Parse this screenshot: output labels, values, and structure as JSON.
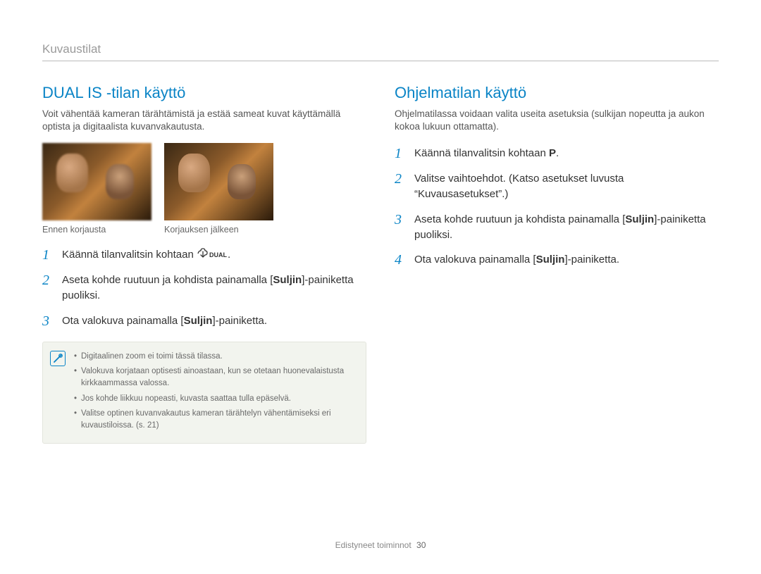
{
  "chapter": "Kuvaustilat",
  "left": {
    "heading": "DUAL IS -tilan käyttö",
    "intro": "Voit vähentää kameran tärähtämistä ja estää sameat kuvat käyttämällä optista ja digitaalista kuvanvakautusta.",
    "photo_before_caption": "Ennen korjausta",
    "photo_after_caption": "Korjauksen jälkeen",
    "steps": [
      {
        "num": "1",
        "pre": "Käännä tilanvalitsin kohtaan ",
        "icon": "dual",
        "post": "."
      },
      {
        "num": "2",
        "pre": "Aseta kohde ruutuun ja kohdista painamalla [",
        "bold": "Suljin",
        "post": "]-painiketta puoliksi."
      },
      {
        "num": "3",
        "pre": "Ota valokuva painamalla [",
        "bold": "Suljin",
        "post": "]-painiketta."
      }
    ],
    "notes": [
      "Digitaalinen zoom ei toimi tässä tilassa.",
      "Valokuva korjataan optisesti ainoastaan, kun se otetaan huonevalaistusta kirkkaammassa valossa.",
      "Jos kohde liikkuu nopeasti, kuvasta saattaa tulla epäselvä.",
      "Valitse optinen kuvanvakautus kameran tärähtelyn vähentämiseksi eri kuvaustiloissa. (s. 21)"
    ]
  },
  "right": {
    "heading": "Ohjelmatilan käyttö",
    "intro": "Ohjelmatilassa voidaan valita useita asetuksia (sulkijan nopeutta ja aukon kokoa lukuun ottamatta).",
    "steps": [
      {
        "num": "1",
        "pre": "Käännä tilanvalitsin kohtaan ",
        "mode": "P",
        "post": "."
      },
      {
        "num": "2",
        "pre": "Valitse vaihtoehdot. (Katso asetukset luvusta “Kuvausasetukset”.)"
      },
      {
        "num": "3",
        "pre": "Aseta kohde ruutuun ja kohdista painamalla [",
        "bold": "Suljin",
        "post": "]-painiketta puoliksi."
      },
      {
        "num": "4",
        "pre": "Ota valokuva painamalla [",
        "bold": "Suljin",
        "post": "]-painiketta."
      }
    ]
  },
  "footer": {
    "section": "Edistyneet toiminnot",
    "page": "30"
  }
}
